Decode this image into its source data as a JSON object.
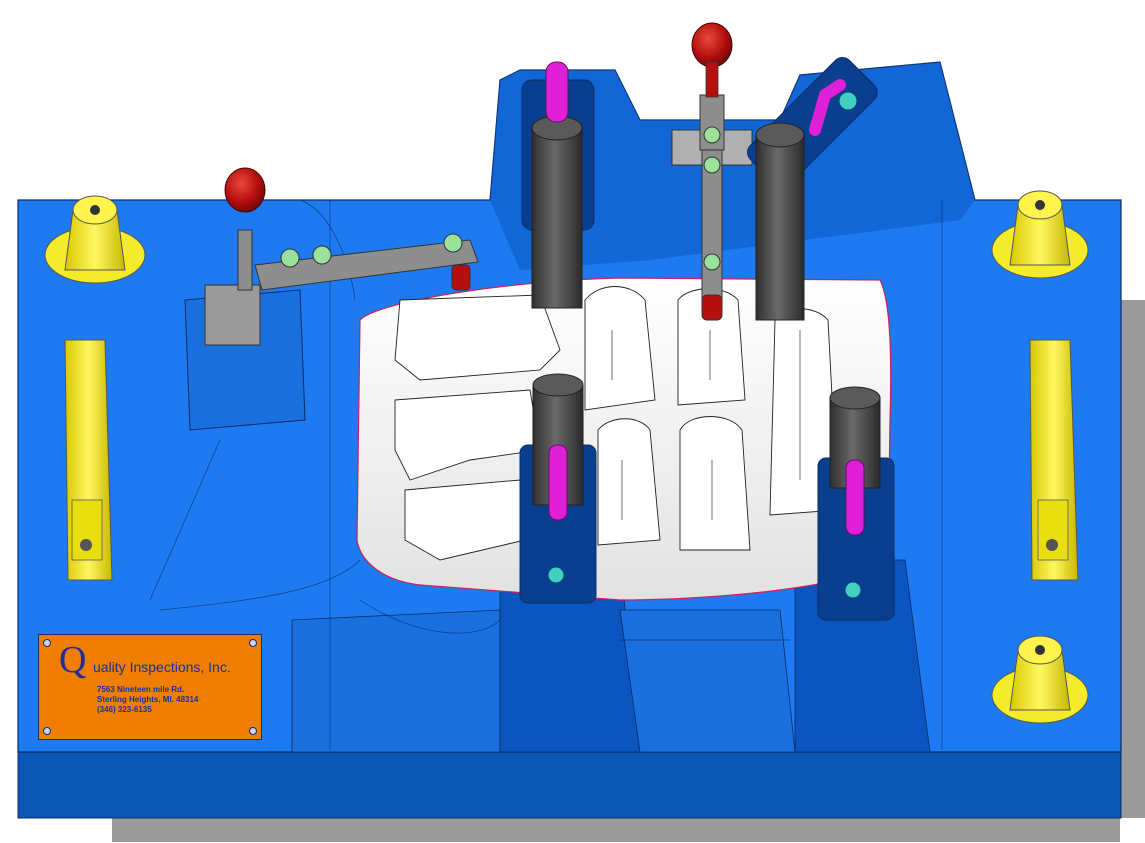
{
  "colors": {
    "fixture_blue": "#1e7af0",
    "fixture_dark_blue": "#0a55c0",
    "base_dark": "#0b57b5",
    "shadow_gray": "#9b9b9b",
    "white_part": "#f1f1f1",
    "clamp_steel": "#8e8e8e",
    "clamp_knob_red": "#b50f0f",
    "locator_post": "#4a4a4a",
    "pin_magenta": "#e020d8",
    "bushing_yellow": "#f4ec2b",
    "plate_orange": "#ee7d00",
    "plate_text": "#1f2e9c"
  },
  "nameplate": {
    "letter": "Q",
    "company": "uality Inspections, Inc.",
    "address_lines": [
      "7563 Nineteen mile Rd.",
      "Sterling Heights, MI. 48314",
      "(346) 323-6135"
    ]
  }
}
